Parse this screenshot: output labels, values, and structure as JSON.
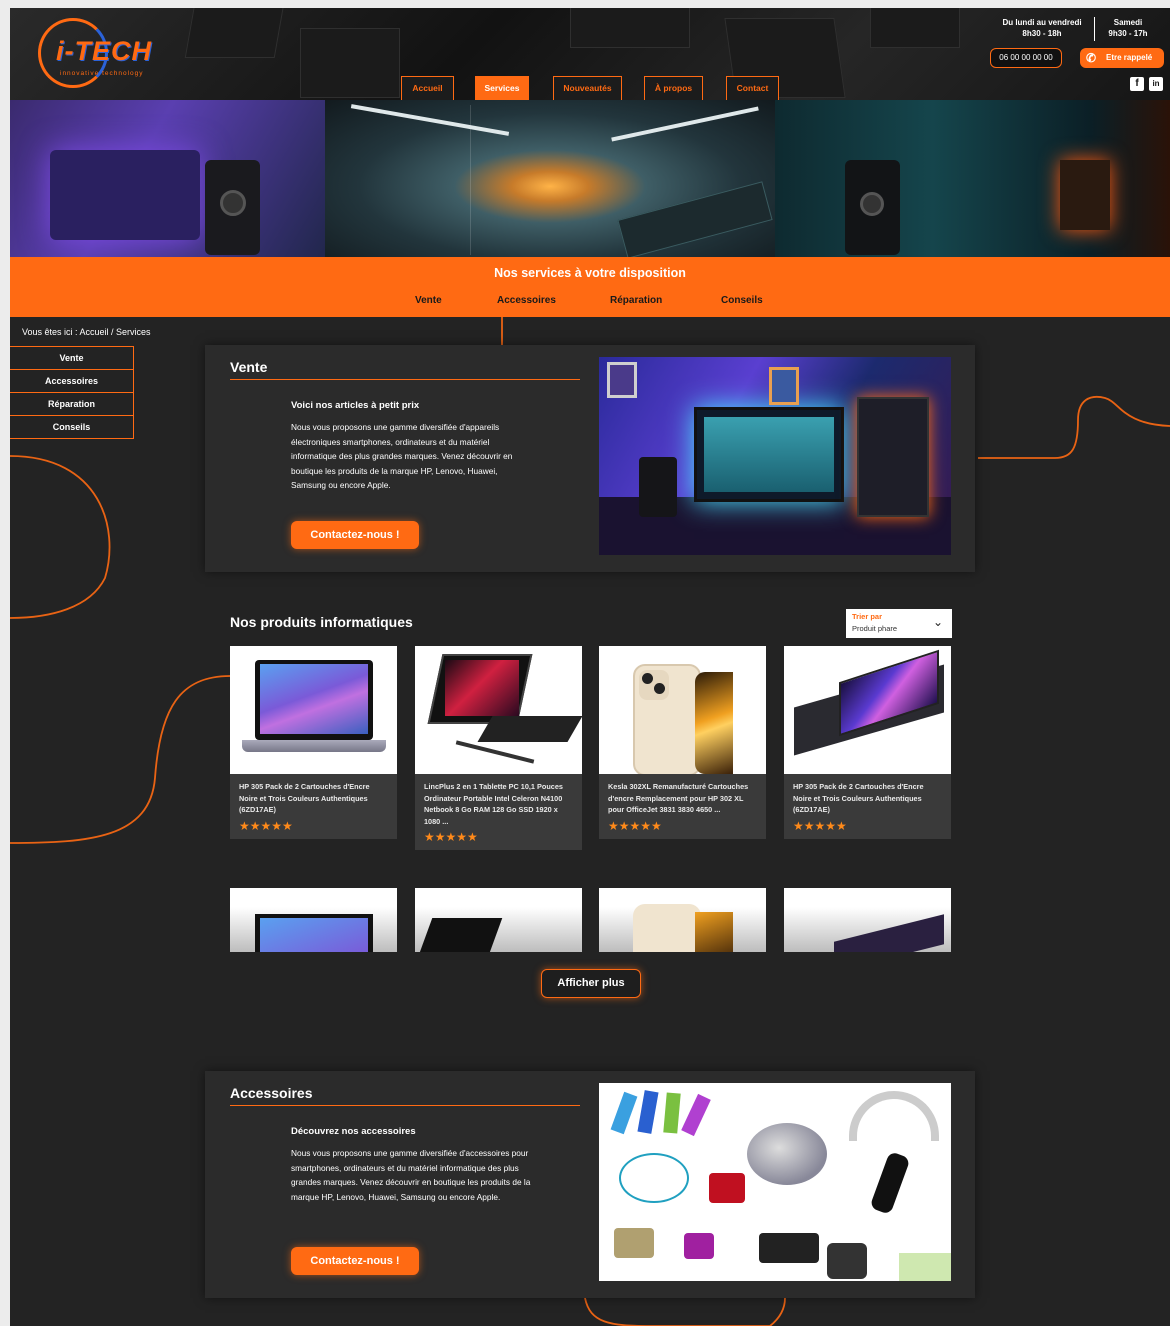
{
  "brand": {
    "name": "i-TECH",
    "tagline": "innovative technology"
  },
  "header": {
    "hours": [
      {
        "days": "Du lundi au vendredi",
        "time": "8h30 - 18h"
      },
      {
        "days": "Samedi",
        "time": "9h30 - 17h"
      }
    ],
    "phone": "06 00 00 00 00",
    "callback_label": "Etre rappelé",
    "social": [
      {
        "icon": "facebook-icon",
        "glyph": "f"
      },
      {
        "icon": "linkedin-icon",
        "glyph": "in"
      }
    ]
  },
  "nav": {
    "items": [
      {
        "label": "Accueil"
      },
      {
        "label": "Services",
        "active": true
      },
      {
        "label": "Nouveautés"
      },
      {
        "label": "À propos"
      },
      {
        "label": "Contact"
      }
    ]
  },
  "services_bar": {
    "title": "Nos services à votre disposition",
    "tabs": [
      "Vente",
      "Accessoires",
      "Réparation",
      "Conseils"
    ]
  },
  "breadcrumb": "Vous êtes ici : Accueil / Services",
  "side_menu": [
    "Vente",
    "Accessoires",
    "Réparation",
    "Conseils"
  ],
  "vente": {
    "title": "Vente",
    "subtitle": "Voici nos articles à petit prix",
    "text": "Nous vous proposons une gamme diversifiée d'appareils électroniques smartphones, ordinateurs et du matériel informatique des plus grandes marques. Venez découvrir en boutique les produits de la marque HP, Lenovo, Huawei, Samsung ou encore Apple.",
    "cta": "Contactez-nous !"
  },
  "products": {
    "title": "Nos produits informatiques",
    "sort": {
      "label": "Trier par",
      "value": "Produit phare"
    },
    "items": [
      {
        "name": "HP 305 Pack de 2 Cartouches d'Encre Noire et Trois Couleurs Authentiques (6ZD17AE)",
        "rating": 5,
        "stars": "★★★★★",
        "image": "laptop"
      },
      {
        "name": "LincPlus 2 en 1 Tablette PC 10,1 Pouces Ordinateur Portable Intel Celeron N4100 Netbook 8 Go RAM 128 Go SSD 1920 x 1080 ...",
        "rating": 5,
        "stars": "★★★★★",
        "image": "tablet-keyboard"
      },
      {
        "name": "Kesla 302XL Remanufacturé Cartouches d'encre Remplacement pour HP 302 XL pour OfficeJet 3831 3830 4650 ...",
        "rating": 5,
        "stars": "★★★★★",
        "image": "iphone"
      },
      {
        "name": "HP 305 Pack de 2 Cartouches d'Encre Noire et Trois Couleurs Authentiques (6ZD17AE)",
        "rating": 5,
        "stars": "★★★★★",
        "image": "ipad"
      }
    ],
    "more_label": "Afficher plus"
  },
  "accessoires": {
    "title": "Accessoires",
    "subtitle": "Découvrez nos accessoires",
    "text": "Nous vous proposons une gamme diversifiée d'accessoires pour smartphones, ordinateurs et du matériel informatique des plus grandes marques. Venez découvrir en boutique les produits de la marque HP, Lenovo, Huawei, Samsung ou encore Apple.",
    "cta": "Contactez-nous !"
  },
  "colors": {
    "accent": "#ff6a13",
    "background": "#232323",
    "card": "#2b2b2b"
  }
}
